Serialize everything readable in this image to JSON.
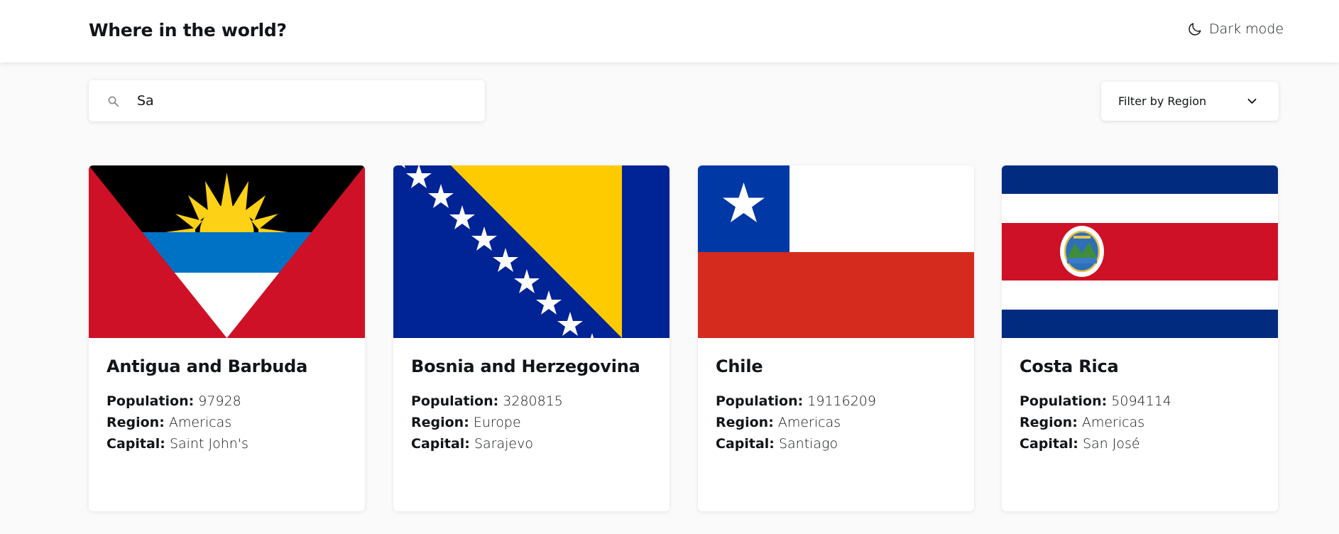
{
  "header": {
    "title": "Where in the world?",
    "theme_toggle_label": "Dark mode",
    "theme_icon": "moon-icon"
  },
  "search": {
    "value": "Sa",
    "icon": "search-icon"
  },
  "filter": {
    "label": "Filter by Region",
    "icon": "chevron-down-icon"
  },
  "labels": {
    "population": "Population:",
    "region": "Region:",
    "capital": "Capital:"
  },
  "countries": [
    {
      "name": "Antigua and Barbuda",
      "population": "97928",
      "region": "Americas",
      "capital": "Saint John's"
    },
    {
      "name": "Bosnia and Herzegovina",
      "population": "3280815",
      "region": "Europe",
      "capital": "Sarajevo"
    },
    {
      "name": "Chile",
      "population": "19116209",
      "region": "Americas",
      "capital": "Santiago"
    },
    {
      "name": "Costa Rica",
      "population": "5094114",
      "region": "Americas",
      "capital": "San José"
    }
  ],
  "colors": {
    "background": "#fafafa",
    "surface": "#ffffff",
    "text": "#111517"
  }
}
